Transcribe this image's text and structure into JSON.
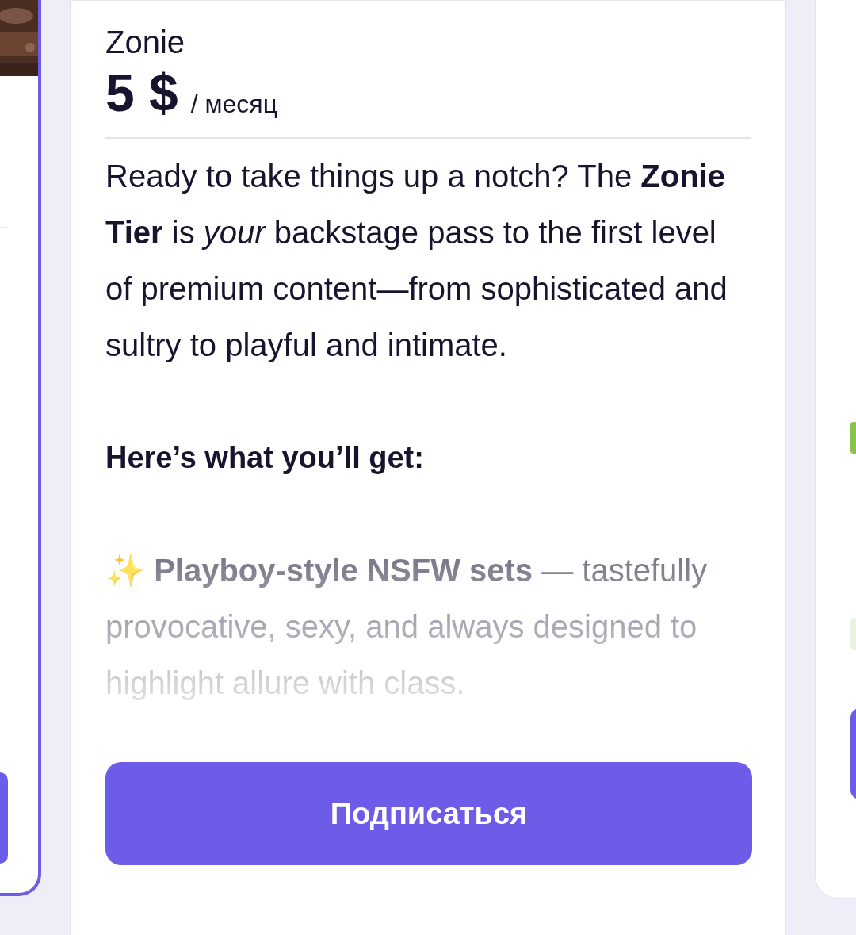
{
  "plans": [
    {
      "kind": "partial_left"
    },
    {
      "kind": "full",
      "name": "Zonie",
      "price": "5 $",
      "period": "/ месяц",
      "description": "Ready to take things up a notch? The **Zonie Tier** is *your* backstage pass to the first level of premium content—from sophisticated and sultry to playful and intimate.",
      "heading": "Here’s what you’ll get:",
      "feature": "✨ **Playboy-style NSFW sets** — tastefully provocative, sexy, and always designed to highlight allure with class.",
      "button": "Подписаться"
    },
    {
      "kind": "partial_right"
    }
  ]
}
